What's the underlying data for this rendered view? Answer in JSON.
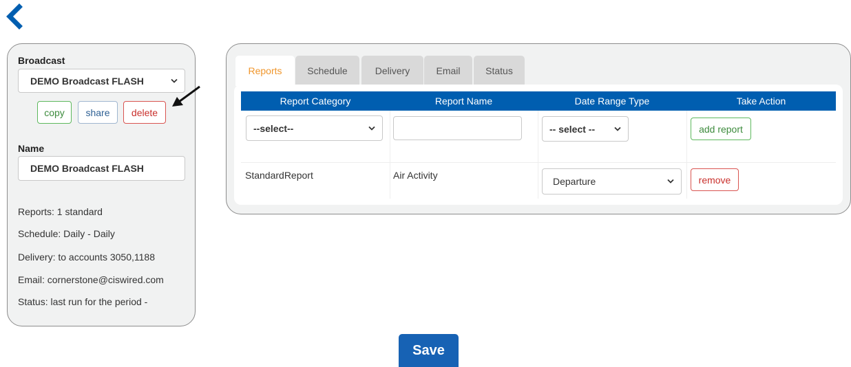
{
  "nav": {
    "back_icon": "chevron-left-icon",
    "accent": "#005eb0"
  },
  "sidebar": {
    "broadcast_label": "Broadcast",
    "broadcast_selected": "DEMO Broadcast FLASH",
    "buttons": {
      "copy": "copy",
      "share": "share",
      "delete": "delete"
    },
    "name_label": "Name",
    "name_value": "DEMO Broadcast FLASH",
    "summary": [
      "Reports: 1 standard",
      "Schedule: Daily - Daily",
      "Delivery: to accounts 3050,1188",
      "Email: cornerstone@ciswired.com",
      "Status: last run for the period -"
    ]
  },
  "tabs": [
    {
      "label": "Reports",
      "active": true
    },
    {
      "label": "Schedule",
      "active": false
    },
    {
      "label": "Delivery",
      "active": false
    },
    {
      "label": "Email",
      "active": false
    },
    {
      "label": "Status",
      "active": false
    }
  ],
  "table": {
    "headers": [
      "Report Category",
      "Report Name",
      "Date Range Type",
      "Take Action"
    ],
    "new_row": {
      "category_select": "--select--",
      "report_name_value": "",
      "date_range_select": "-- select --",
      "action": "add report"
    },
    "rows": [
      {
        "category": "StandardReport",
        "name": "Air Activity",
        "date_range": "Departure",
        "action": "remove"
      }
    ]
  },
  "footer": {
    "save_label": "Save"
  },
  "colors": {
    "header_bg": "#005eb0",
    "active_tab": "#f0962c",
    "save_bg": "#1762b4"
  }
}
